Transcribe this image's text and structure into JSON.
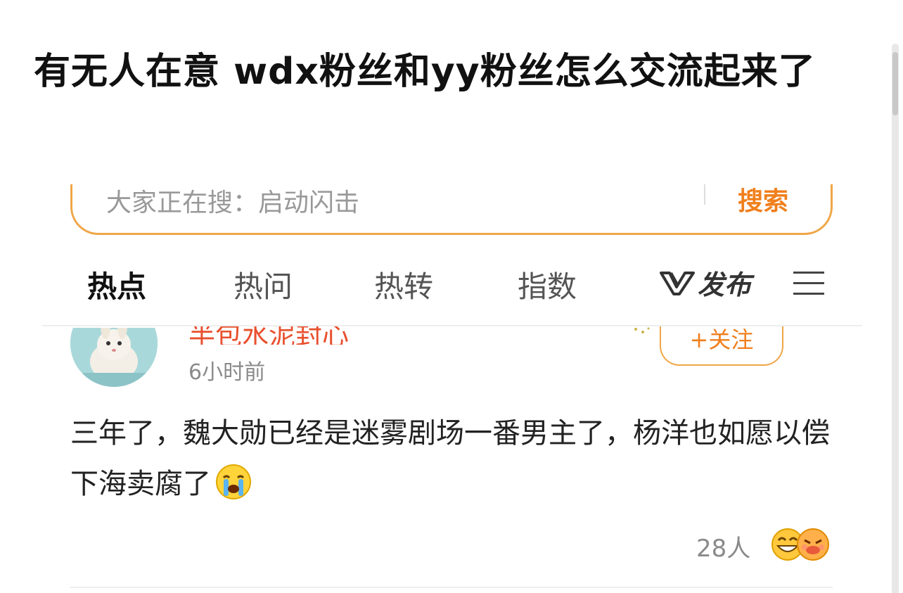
{
  "headline": "有无人在意 wdx粉丝和yy粉丝怎么交流起来了",
  "search": {
    "placeholder_text": "大家正在搜：启动闪击",
    "button_label": "搜索"
  },
  "tabs": [
    {
      "label": "热点",
      "active": true
    },
    {
      "label": "热问",
      "active": false
    },
    {
      "label": "热转",
      "active": false
    },
    {
      "label": "指数",
      "active": false
    }
  ],
  "publish_label": "发布",
  "post": {
    "username": "半包水泥封心",
    "time": "6小时前",
    "follow_label": "+关注",
    "body": "三年了，魏大勋已经是迷雾剧场一番男主了，杨洋也如愿以偿下海卖腐了",
    "reaction_count": "28人"
  },
  "colors": {
    "accent_orange": "#f07f1c",
    "search_border": "#f0a648",
    "username_red": "#e8502e"
  }
}
